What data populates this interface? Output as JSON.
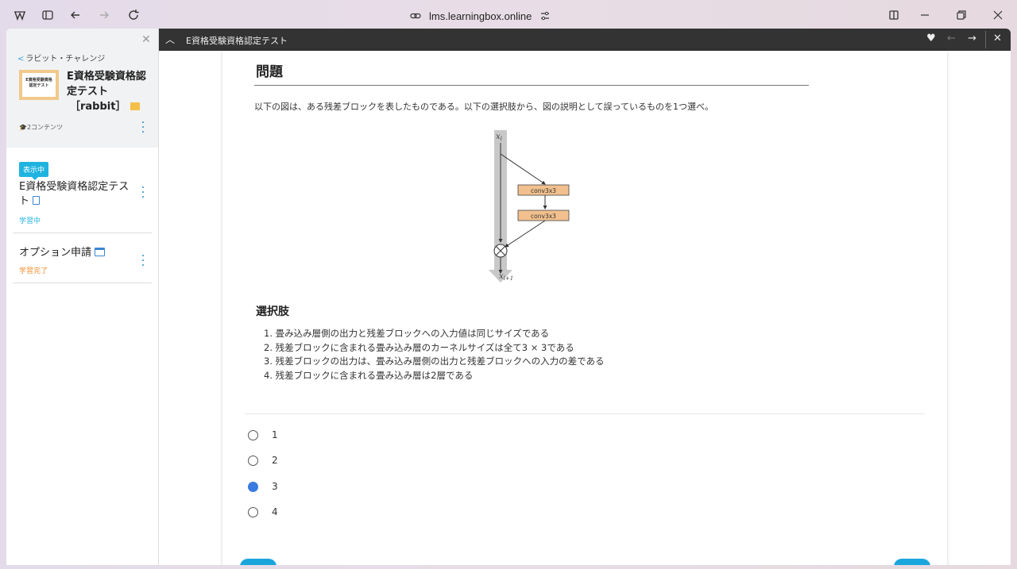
{
  "browser": {
    "url": "lms.learningbox.online"
  },
  "sidebar": {
    "back_label": "ラビット・チャレンジ",
    "course_title_line1": "E資格受験資格認",
    "course_title_line2": "定テスト",
    "course_title_line3": "［rabbit］",
    "thumb_text_line1": "E資格受験資格",
    "thumb_text_line2": "認定テスト",
    "content_count": "2コンテンツ",
    "badge": "表示中",
    "items": [
      {
        "title_line1": "E資格受験資格認定テス",
        "title_line2": "ト",
        "status": "学習中",
        "status_color": "#1fb3e0"
      },
      {
        "title_line1": "オプション申請",
        "status": "学習完了",
        "status_color": "#f08c2e"
      }
    ]
  },
  "topbar": {
    "title": "E資格受験資格認定テスト"
  },
  "question": {
    "heading": "問題",
    "text": "以下の図は、ある残差ブロックを表したものである。以下の選択肢から、図の説明として誤っているものを1つ選べ。",
    "figure": {
      "x_top": "x",
      "x_top_sub": "l",
      "x_bottom": "x",
      "x_bottom_sub": "l+1",
      "conv1": "conv3x3",
      "conv2": "conv3x3"
    },
    "choices_heading": "選択肢",
    "choices": [
      "1. 畳み込み層側の出力と残差ブロックへの入力値は同じサイズである",
      "2. 残差ブロックに含まれる畳み込み層のカーネルサイズは全て3 × 3である",
      "3. 残差ブロックの出力は、畳み込み層側の出力と残差ブロックへの入力の差である",
      "4. 残差ブロックに含まれる畳み込み層は2層である"
    ],
    "options": [
      {
        "label": "1",
        "selected": false
      },
      {
        "label": "2",
        "selected": false
      },
      {
        "label": "3",
        "selected": true
      },
      {
        "label": "4",
        "selected": false
      }
    ]
  },
  "colors": {
    "accent": "#1fb3e0",
    "radio_selected": "#3a7be0",
    "topbar": "#333333"
  }
}
